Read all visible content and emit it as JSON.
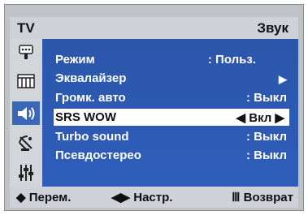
{
  "header": {
    "left": "TV",
    "right": "Звук"
  },
  "menu": [
    {
      "label": "Режим",
      "value": ": Польз."
    },
    {
      "label": "Эквалайзер",
      "value": "▶"
    },
    {
      "label": "Громк. авто",
      "value": ":  Выкл"
    },
    {
      "label": "SRS WOW",
      "value": "◀ Вкл ▶"
    },
    {
      "label": "Turbo sound",
      "value": ":  Выкл"
    },
    {
      "label": "Псевдостерео",
      "value": ":  Выкл"
    }
  ],
  "footer": {
    "move": "◆ Перем.",
    "adjust": "◀▶ Настр.",
    "back": "Ⅲ Возврат"
  },
  "icons": [
    "input-icon",
    "picture-icon",
    "sound-icon",
    "channel-icon",
    "setup-icon"
  ]
}
